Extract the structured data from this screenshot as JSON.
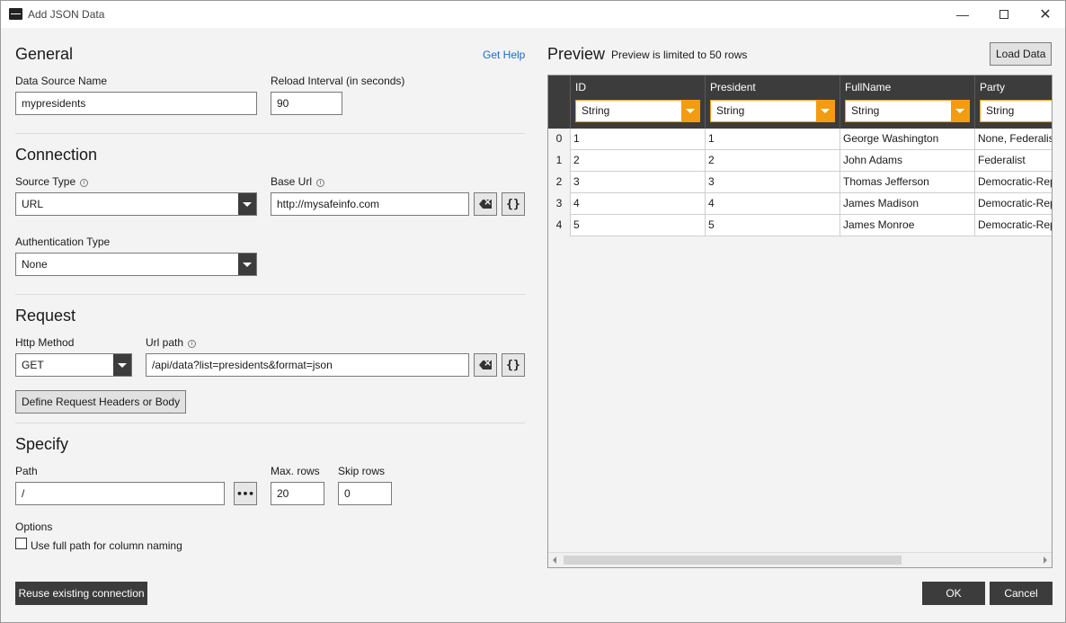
{
  "window": {
    "title": "Add JSON Data"
  },
  "general": {
    "title": "General",
    "help": "Get Help",
    "ds_name_label": "Data Source Name",
    "ds_name_value": "mypresidents",
    "reload_label": "Reload Interval (in seconds)",
    "reload_value": "90"
  },
  "connection": {
    "title": "Connection",
    "source_type_label": "Source Type",
    "source_type_value": "URL",
    "base_url_label": "Base Url",
    "base_url_value": "http://mysafeinfo.com",
    "auth_label": "Authentication Type",
    "auth_value": "None"
  },
  "request": {
    "title": "Request",
    "method_label": "Http Method",
    "method_value": "GET",
    "url_path_label": "Url path",
    "url_path_value": "/api/data?list=presidents&format=json",
    "define_button": "Define Request Headers or Body"
  },
  "specify": {
    "title": "Specify",
    "path_label": "Path",
    "path_value": "/",
    "path_button": "•••",
    "max_rows_label": "Max. rows",
    "max_rows_value": "20",
    "skip_rows_label": "Skip rows",
    "skip_rows_value": "0",
    "options_label": "Options",
    "full_path_label": "Use full path for column naming"
  },
  "preview": {
    "title": "Preview",
    "note": "Preview is limited to 50 rows",
    "load_button": "Load Data",
    "columns": [
      {
        "name": "ID",
        "type": "String"
      },
      {
        "name": "President",
        "type": "String"
      },
      {
        "name": "FullName",
        "type": "String"
      },
      {
        "name": "Party",
        "type": "String"
      }
    ],
    "rows": [
      {
        "num": "0",
        "cells": [
          "1",
          "1",
          "George Washington",
          "None, Federalist"
        ]
      },
      {
        "num": "1",
        "cells": [
          "2",
          "2",
          "John Adams",
          "Federalist"
        ]
      },
      {
        "num": "2",
        "cells": [
          "3",
          "3",
          "Thomas Jefferson",
          "Democratic-Republican"
        ]
      },
      {
        "num": "3",
        "cells": [
          "4",
          "4",
          "James Madison",
          "Democratic-Republican"
        ]
      },
      {
        "num": "4",
        "cells": [
          "5",
          "5",
          "James Monroe",
          "Democratic-Republican"
        ]
      }
    ]
  },
  "footer": {
    "reuse_button": "Reuse existing connection",
    "ok_button": "OK",
    "cancel_button": "Cancel"
  }
}
